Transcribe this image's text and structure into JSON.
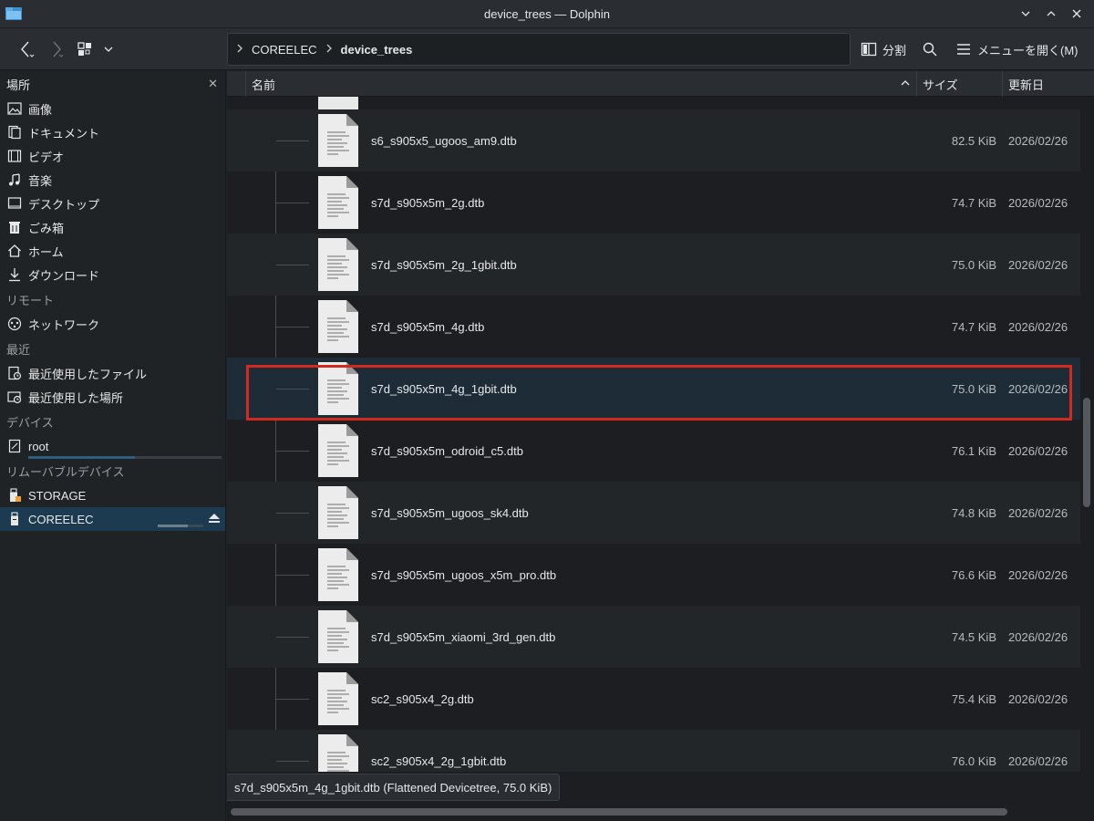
{
  "window": {
    "title": "device_trees — Dolphin"
  },
  "toolbar": {
    "breadcrumbs": [
      "COREELEC",
      "device_trees"
    ],
    "split_label": "分割",
    "menu_label": "メニューを開く(M)"
  },
  "sidebar": {
    "header": "場所",
    "places": [
      {
        "icon": "image-icon",
        "label": "画像"
      },
      {
        "icon": "document-icon",
        "label": "ドキュメント"
      },
      {
        "icon": "video-icon",
        "label": "ビデオ"
      },
      {
        "icon": "music-icon",
        "label": "音楽"
      },
      {
        "icon": "desktop-icon",
        "label": "デスクトップ"
      },
      {
        "icon": "trash-icon",
        "label": "ごみ箱"
      },
      {
        "icon": "home-icon",
        "label": "ホーム"
      },
      {
        "icon": "download-icon",
        "label": "ダウンロード"
      }
    ],
    "remote_section": "リモート",
    "remote": [
      {
        "icon": "network-icon",
        "label": "ネットワーク"
      }
    ],
    "recent_section": "最近",
    "recent": [
      {
        "icon": "recent-files-icon",
        "label": "最近使用したファイル"
      },
      {
        "icon": "recent-locations-icon",
        "label": "最近使用した場所"
      }
    ],
    "devices_section": "デバイス",
    "devices": [
      {
        "icon": "drive-icon",
        "label": "root",
        "usage": 0.55
      }
    ],
    "removable_section": "リムーバブルデバイス",
    "removable": [
      {
        "icon": "usb-icon",
        "label": "STORAGE"
      },
      {
        "icon": "usb-icon",
        "label": "COREELEC",
        "usage": 0.65,
        "selected": true
      }
    ]
  },
  "columns": {
    "name": "名前",
    "size": "サイズ",
    "modified": "更新日"
  },
  "files": [
    {
      "name": "s6_s905x5_ugoos_am9.dtb",
      "size": "82.5 KiB",
      "date": "2026/02/26"
    },
    {
      "name": "s7d_s905x5m_2g.dtb",
      "size": "74.7 KiB",
      "date": "2026/02/26"
    },
    {
      "name": "s7d_s905x5m_2g_1gbit.dtb",
      "size": "75.0 KiB",
      "date": "2026/02/26"
    },
    {
      "name": "s7d_s905x5m_4g.dtb",
      "size": "74.7 KiB",
      "date": "2026/02/26"
    },
    {
      "name": "s7d_s905x5m_4g_1gbit.dtb",
      "size": "75.0 KiB",
      "date": "2026/02/26",
      "selected": true
    },
    {
      "name": "s7d_s905x5m_odroid_c5.dtb",
      "size": "76.1 KiB",
      "date": "2026/02/26"
    },
    {
      "name": "s7d_s905x5m_ugoos_sk4.dtb",
      "size": "74.8 KiB",
      "date": "2026/02/26"
    },
    {
      "name": "s7d_s905x5m_ugoos_x5m_pro.dtb",
      "size": "76.6 KiB",
      "date": "2026/02/26"
    },
    {
      "name": "s7d_s905x5m_xiaomi_3rd_gen.dtb",
      "size": "74.5 KiB",
      "date": "2026/02/26"
    },
    {
      "name": "sc2_s905x4_2g.dtb",
      "size": "75.4 KiB",
      "date": "2026/02/26"
    },
    {
      "name": "sc2_s905x4_2g_1gbit.dtb",
      "size": "76.0 KiB",
      "date": "2026/02/26"
    }
  ],
  "status": {
    "text": "s7d_s905x5m_4g_1gbit.dtb (Flattened Devicetree, 75.0 KiB)"
  }
}
